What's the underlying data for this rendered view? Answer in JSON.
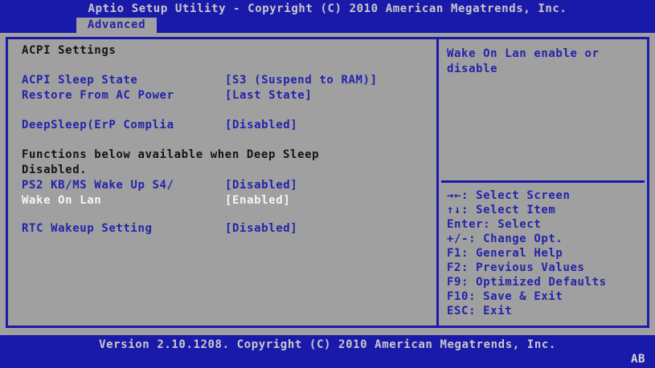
{
  "colors": {
    "blue_accent": "#1a1aaa",
    "background_gray": "#a0a0a0",
    "text_blue": "#2323ac",
    "text_black": "#141414",
    "text_selected_white": "#f5f5f5",
    "bar_text_gray": "#c9c9c9"
  },
  "header": {
    "title": "Aptio Setup Utility - Copyright (C) 2010 American Megatrends, Inc.",
    "tabs": [
      {
        "label": "Advanced",
        "active": true
      }
    ]
  },
  "left_panel": {
    "section_title": "ACPI Settings",
    "items": [
      {
        "label": "ACPI Sleep State",
        "value": "[S3 (Suspend to RAM)]",
        "selected": false
      },
      {
        "label": "Restore From AC Power",
        "value": "[Last State]",
        "selected": false
      },
      {
        "label": "DeepSleep(ErP Complia",
        "value": "[Disabled]",
        "selected": false
      },
      {
        "label": "PS2 KB/MS Wake Up S4/",
        "value": "[Disabled]",
        "selected": false
      },
      {
        "label": "Wake On Lan",
        "value": "[Enabled]",
        "selected": true
      },
      {
        "label": "RTC Wakeup Setting",
        "value": "[Disabled]",
        "selected": false
      }
    ],
    "note_lines": [
      "Functions below available when Deep Sleep",
      "Disabled."
    ]
  },
  "right_panel": {
    "help_text": "Wake On Lan enable or disable",
    "hotkeys": [
      "→←: Select Screen",
      "↑↓: Select Item",
      "Enter: Select",
      "+/-: Change Opt.",
      "F1: General Help",
      "F2: Previous Values",
      "F9: Optimized Defaults",
      "F10: Save & Exit",
      "ESC: Exit"
    ]
  },
  "footer": {
    "version_text": "Version 2.10.1208. Copyright (C) 2010 American Megatrends, Inc.",
    "build_id": "AB"
  }
}
